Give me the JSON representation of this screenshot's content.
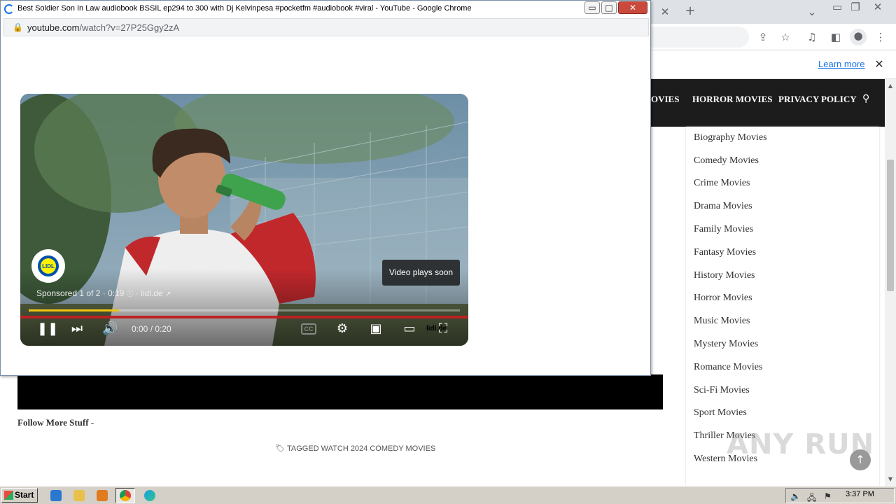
{
  "popup": {
    "title": "Best Soldier Son In Law audiobook BSSIL ep294 to 300 with Dj Kelvinpesa #pocketfm #audiobook #viral - YouTube - Google Chrome",
    "url_host": "youtube.com",
    "url_path": "/watch?v=27P25Ggy2zA"
  },
  "player": {
    "plays_soon": "Video plays soon",
    "sponsored": "Sponsored 1 of 2 · 0:19",
    "ad_domain": "lidl.de",
    "time": "0:00 / 0:20",
    "brand_badge": "lidl.de",
    "ad_progress_fraction": 0.21,
    "cc_label": "CC"
  },
  "browser": {
    "learn_more": "Learn more"
  },
  "nav": {
    "items": [
      "OVIES",
      "HORROR MOVIES",
      "PRIVACY POLICY"
    ]
  },
  "sidebar": {
    "items": [
      "Biography Movies",
      "Comedy Movies",
      "Crime Movies",
      "Drama Movies",
      "Family Movies",
      "Fantasy Movies",
      "History Movies",
      "Horror Movies",
      "Music Movies",
      "Mystery Movies",
      "Romance Movies",
      "Sci-Fi Movies",
      "Sport Movies",
      "Thriller Movies",
      "Western Movies"
    ]
  },
  "page": {
    "follow": "Follow More Stuff -",
    "tagged": "TAGGED WATCH 2024 COMEDY MOVIES"
  },
  "watermark": "ANY RUN",
  "taskbar": {
    "start": "Start",
    "clock": "3:37 PM"
  },
  "colors": {
    "nav_bg": "#1c1c1c",
    "link_blue": "#1a73e8",
    "progress_red": "#b22222",
    "ad_progress": "#f1c40f"
  }
}
